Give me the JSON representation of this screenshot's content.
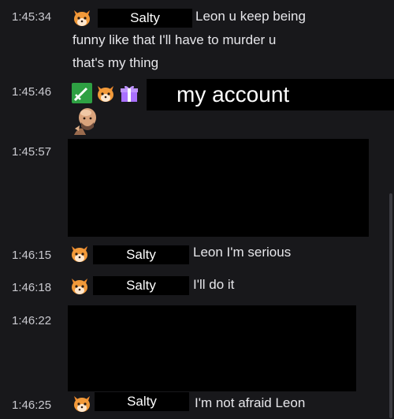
{
  "messages": [
    {
      "time": "1:45:34",
      "badge": "fox-emote-icon",
      "username": "Salty",
      "text_lines": [
        "Leon u keep being",
        "funny like that I'll have to murder u",
        "that's my thing"
      ]
    },
    {
      "time": "1:45:46",
      "badges": [
        "sword-badge-icon",
        "fox-emote-icon",
        "gift-badge-icon",
        "bald-man-avatar-icon"
      ],
      "username": "my account"
    },
    {
      "time": "1:45:57",
      "redacted": true
    },
    {
      "time": "1:46:15",
      "badge": "fox-emote-icon",
      "username": "Salty",
      "text": "Leon I'm serious"
    },
    {
      "time": "1:46:18",
      "badge": "fox-emote-icon",
      "username": "Salty",
      "text": "I'll do it"
    },
    {
      "time": "1:46:22",
      "redacted": true
    },
    {
      "time": "1:46:25",
      "badge": "fox-emote-icon",
      "username": "Salty",
      "text": "I'm not afraid Leon"
    }
  ],
  "colors": {
    "background": "#18181b",
    "timestamp": "#c9c9cf",
    "message_text": "#e6e6ea",
    "redaction": "#000000",
    "sword_badge": "#2ea043",
    "gift_badge": "#a970ff"
  }
}
